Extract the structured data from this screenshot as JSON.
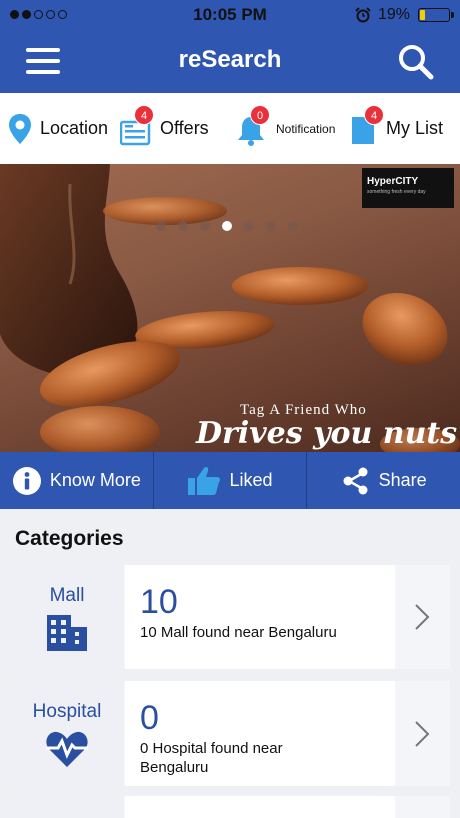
{
  "status_bar": {
    "time": "10:05 PM",
    "battery_percent": "19%",
    "battery_level": 0.19,
    "signal_bars_filled": 2,
    "signal_bars_total": 5
  },
  "app_bar": {
    "title": "reSearch",
    "menu_icon": "hamburger-menu-icon",
    "search_icon": "search-icon"
  },
  "quick_links": [
    {
      "label": "Location",
      "icon": "location-pin-icon",
      "badge": ""
    },
    {
      "label": "Offers",
      "icon": "offers-icon",
      "badge": "4"
    },
    {
      "label": "Notification",
      "icon": "bell-icon",
      "badge": "0"
    },
    {
      "label": "My List",
      "icon": "list-icon",
      "badge": "4"
    }
  ],
  "banner": {
    "brand_name": "HyperCITY",
    "brand_tagline": "something fresh every day",
    "caption_line1": "Tag A Friend Who",
    "caption_line2": "Drives you nuts",
    "page_count": 7,
    "active_page": 4
  },
  "actions": [
    {
      "label": "Know More",
      "icon": "info-icon"
    },
    {
      "label": "Liked",
      "icon": "thumbs-up-icon"
    },
    {
      "label": "Share",
      "icon": "share-icon"
    }
  ],
  "categories": {
    "heading": "Categories",
    "items": [
      {
        "name": "Mall",
        "icon": "building-icon",
        "count": "10",
        "description": "10 Mall found near Bengaluru"
      },
      {
        "name": "Hospital",
        "icon": "heart-pulse-icon",
        "count": "0",
        "description": "0 Hospital found near Bengaluru"
      }
    ]
  },
  "colors": {
    "primary": "#2f56b0",
    "accent_text": "#2a4ea0",
    "badge": "#e8313a",
    "icon_blue": "#3aa3e8"
  }
}
